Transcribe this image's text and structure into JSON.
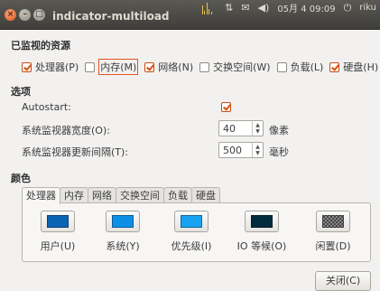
{
  "window": {
    "title": "indicator-multiload",
    "close_glyph": "×",
    "minimize_glyph": "–",
    "maximize_glyph": "□"
  },
  "tray": {
    "datetime": "05月 4 09:09",
    "user": "riku",
    "icons": [
      "network-arrows-icon",
      "mail-icon",
      "volume-icon",
      "power-icon"
    ]
  },
  "monitored": {
    "title": "已监视的资源",
    "items": [
      {
        "label": "处理器(P)",
        "checked": true
      },
      {
        "label": "内存(M)",
        "checked": false
      },
      {
        "label": "网络(N)",
        "checked": true
      },
      {
        "label": "交换空间(W)",
        "checked": false
      },
      {
        "label": "负载(L)",
        "checked": false
      },
      {
        "label": "硬盘(H)",
        "checked": true
      }
    ]
  },
  "options": {
    "title": "选项",
    "autostart_label": "Autostart:",
    "autostart_checked": true,
    "width_label": "系统监视器宽度(O):",
    "width_value": "40",
    "width_unit": "像素",
    "interval_label": "系统监视器更新间隔(T):",
    "interval_value": "500",
    "interval_unit": "毫秒"
  },
  "colors": {
    "title": "颜色",
    "tabs": [
      "处理器",
      "内存",
      "网络",
      "交换空间",
      "负载",
      "硬盘"
    ],
    "active_tab": 0,
    "items": [
      {
        "label": "用户(U)",
        "color": "#0a64b4"
      },
      {
        "label": "系统(Y)",
        "color": "#0d8fe6"
      },
      {
        "label": "优先级(I)",
        "color": "#18a2f2"
      },
      {
        "label": "IO 等候(O)",
        "color": "#032b3f"
      },
      {
        "label": "闲置(D)",
        "color": "checker"
      }
    ]
  },
  "buttons": {
    "close_label": "关闭(C)"
  }
}
